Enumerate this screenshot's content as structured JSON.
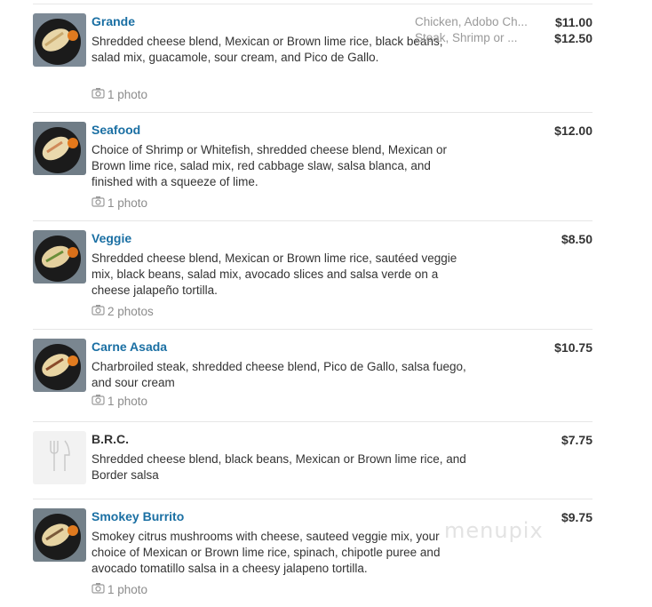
{
  "items": [
    {
      "name": "Grande",
      "description": "Shredded cheese blend, Mexican or Brown lime rice, black beans, salad mix, guacamole, sour cream, and Pico de Gallo.",
      "photos": "1 photo",
      "variants": [
        "Chicken, Adobo Ch...",
        "Steak, Shrimp or ..."
      ],
      "prices": [
        "$11.00",
        "$12.50"
      ]
    },
    {
      "name": "Seafood",
      "description": "Choice of Shrimp or Whitefish, shredded cheese blend, Mexican or Brown lime rice, salad mix, red cabbage slaw, salsa blanca, and finished with a squeeze of lime.",
      "photos": "1 photo",
      "prices": [
        "$12.00"
      ]
    },
    {
      "name": "Veggie",
      "description": "Shredded cheese blend, Mexican or Brown lime rice, sautéed veggie mix, black beans, salad mix, avocado slices and salsa verde on a cheese jalapeño tortilla.",
      "photos": "2 photos",
      "prices": [
        "$8.50"
      ]
    },
    {
      "name": "Carne Asada",
      "description": "Charbroiled steak, shredded cheese blend, Pico de Gallo, salsa fuego, and sour cream",
      "photos": "1 photo",
      "prices": [
        "$10.75"
      ]
    },
    {
      "name": "B.R.C.",
      "description": "Shredded cheese blend, black beans, Mexican or Brown lime rice, and Border salsa",
      "prices": [
        "$7.75"
      ]
    },
    {
      "name": "Smokey Burrito",
      "description": "Smokey citrus mushrooms with cheese, sauteed veggie mix, your choice of Mexican or Brown lime rice, spinach, chipotle puree and avocado tomatillo salsa in a cheesy jalapeno tortilla.",
      "photos": "1 photo",
      "prices": [
        "$9.75"
      ]
    }
  ],
  "watermark": "menupix",
  "icons": {
    "camera": "camera-icon",
    "placeholder": "fork-knife-icon"
  }
}
